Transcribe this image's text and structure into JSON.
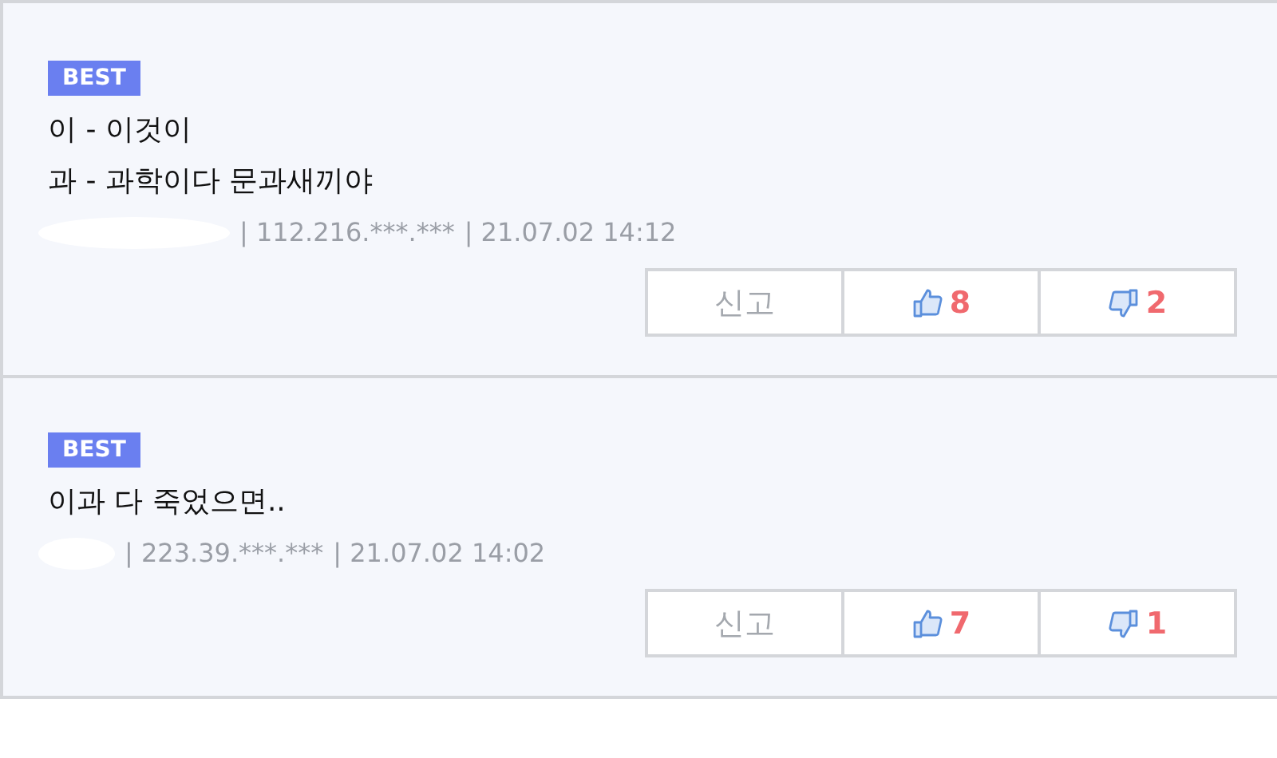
{
  "comments": [
    {
      "badge": "BEST",
      "lines": [
        "이 - 이것이",
        "과 - 과학이다 문과새끼야"
      ],
      "ip": "| 112.216.***.***",
      "date": "| 21.07.02 14:12",
      "report": "신고",
      "likes": "8",
      "dislikes": "2"
    },
    {
      "badge": "BEST",
      "lines": [
        "이과 다 죽었으면.."
      ],
      "ip": "| 223.39.***.***",
      "date": "| 21.07.02 14:02",
      "report": "신고",
      "likes": "7",
      "dislikes": "1"
    }
  ]
}
